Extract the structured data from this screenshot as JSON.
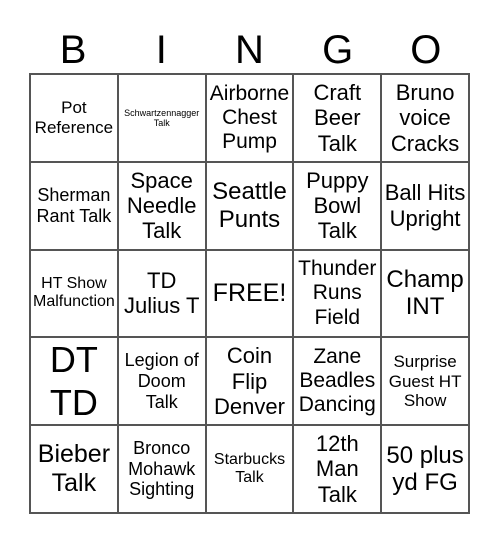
{
  "header": [
    "B",
    "I",
    "N",
    "G",
    "O"
  ],
  "cells": [
    [
      "Pot Reference",
      "Schwartzennagger Talk",
      "Airborne Chest Pump",
      "Craft Beer Talk",
      "Bruno voice Cracks"
    ],
    [
      "Sherman Rant Talk",
      "Space Needle Talk",
      "Seattle Punts",
      "Puppy Bowl Talk",
      "Ball Hits Upright"
    ],
    [
      "HT Show Malfunction",
      "TD Julius T",
      "FREE!",
      "Thunder Runs Field",
      "Champ INT"
    ],
    [
      "DT TD",
      "Legion of Doom Talk",
      "Coin Flip Denver",
      "Zane Beadles Dancing",
      "Surprise Guest HT Show"
    ],
    [
      "Bieber Talk",
      "Bronco Mohawk Sighting",
      "Starbucks Talk",
      "12th Man Talk",
      "50 plus yd FG"
    ]
  ]
}
